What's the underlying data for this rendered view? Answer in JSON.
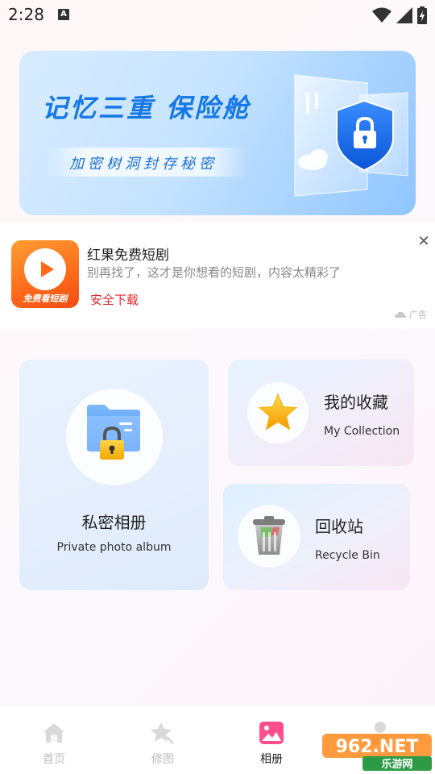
{
  "status_bar": {
    "time": "2:28",
    "notification_letter": "A"
  },
  "banner": {
    "title": "记忆三重 保险舱",
    "subtitle": "加密树洞封存秘密"
  },
  "ad": {
    "icon_label": "免费看短剧",
    "title": "红果免费短剧",
    "description": "别再找了，这才是你想看的短剧，内容太精彩了",
    "cta": "安全下载",
    "close_symbol": "✕",
    "tag": "广告"
  },
  "cards": {
    "private": {
      "title": "私密相册",
      "subtitle": "Private photo album"
    },
    "collection": {
      "title": "我的收藏",
      "subtitle": "My Collection"
    },
    "recycle": {
      "title": "回收站",
      "subtitle": "Recycle Bin"
    }
  },
  "nav": {
    "items": [
      {
        "label": "首页",
        "icon": "home-icon",
        "active": false
      },
      {
        "label": "修图",
        "icon": "star-edit-icon",
        "active": false
      },
      {
        "label": "相册",
        "icon": "album-icon",
        "active": true
      },
      {
        "label": "",
        "icon": "profile-icon",
        "active": false
      }
    ]
  },
  "watermark": {
    "brand": "962.NET",
    "sub": "乐游网"
  },
  "colors": {
    "accent_blue": "#1677e6",
    "ad_cta_red": "#e0282e",
    "album_pink": "#ff4f8b"
  }
}
